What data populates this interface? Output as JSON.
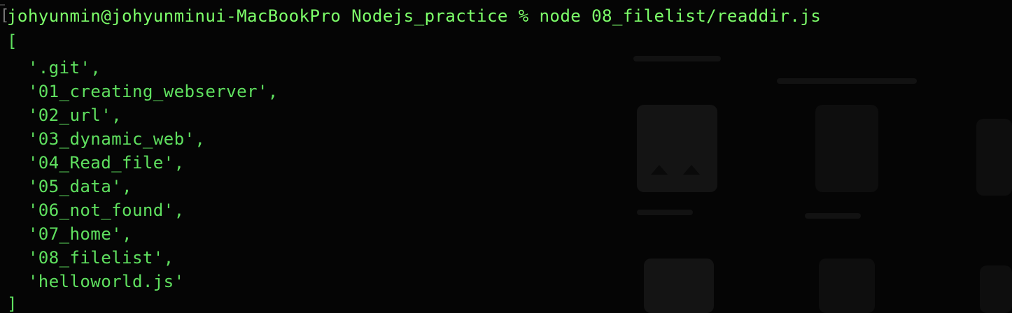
{
  "terminal": {
    "prompt": "johyunmin@johyunminui-MacBookPro Nodejs_practice % node 08_filelist/readdir.js",
    "output_lines": [
      "[",
      "  '.git',",
      "  '01_creating_webserver',",
      "  '02_url',",
      "  '03_dynamic_web',",
      "  '04_Read_file',",
      "  '05_data',",
      "  '06_not_found',",
      "  '07_home',",
      "  '08_filelist',",
      "  'helloworld.js'",
      "]"
    ]
  },
  "colors": {
    "background": "#050505",
    "text": "#5fe05f",
    "prompt": "#7dff6a"
  }
}
